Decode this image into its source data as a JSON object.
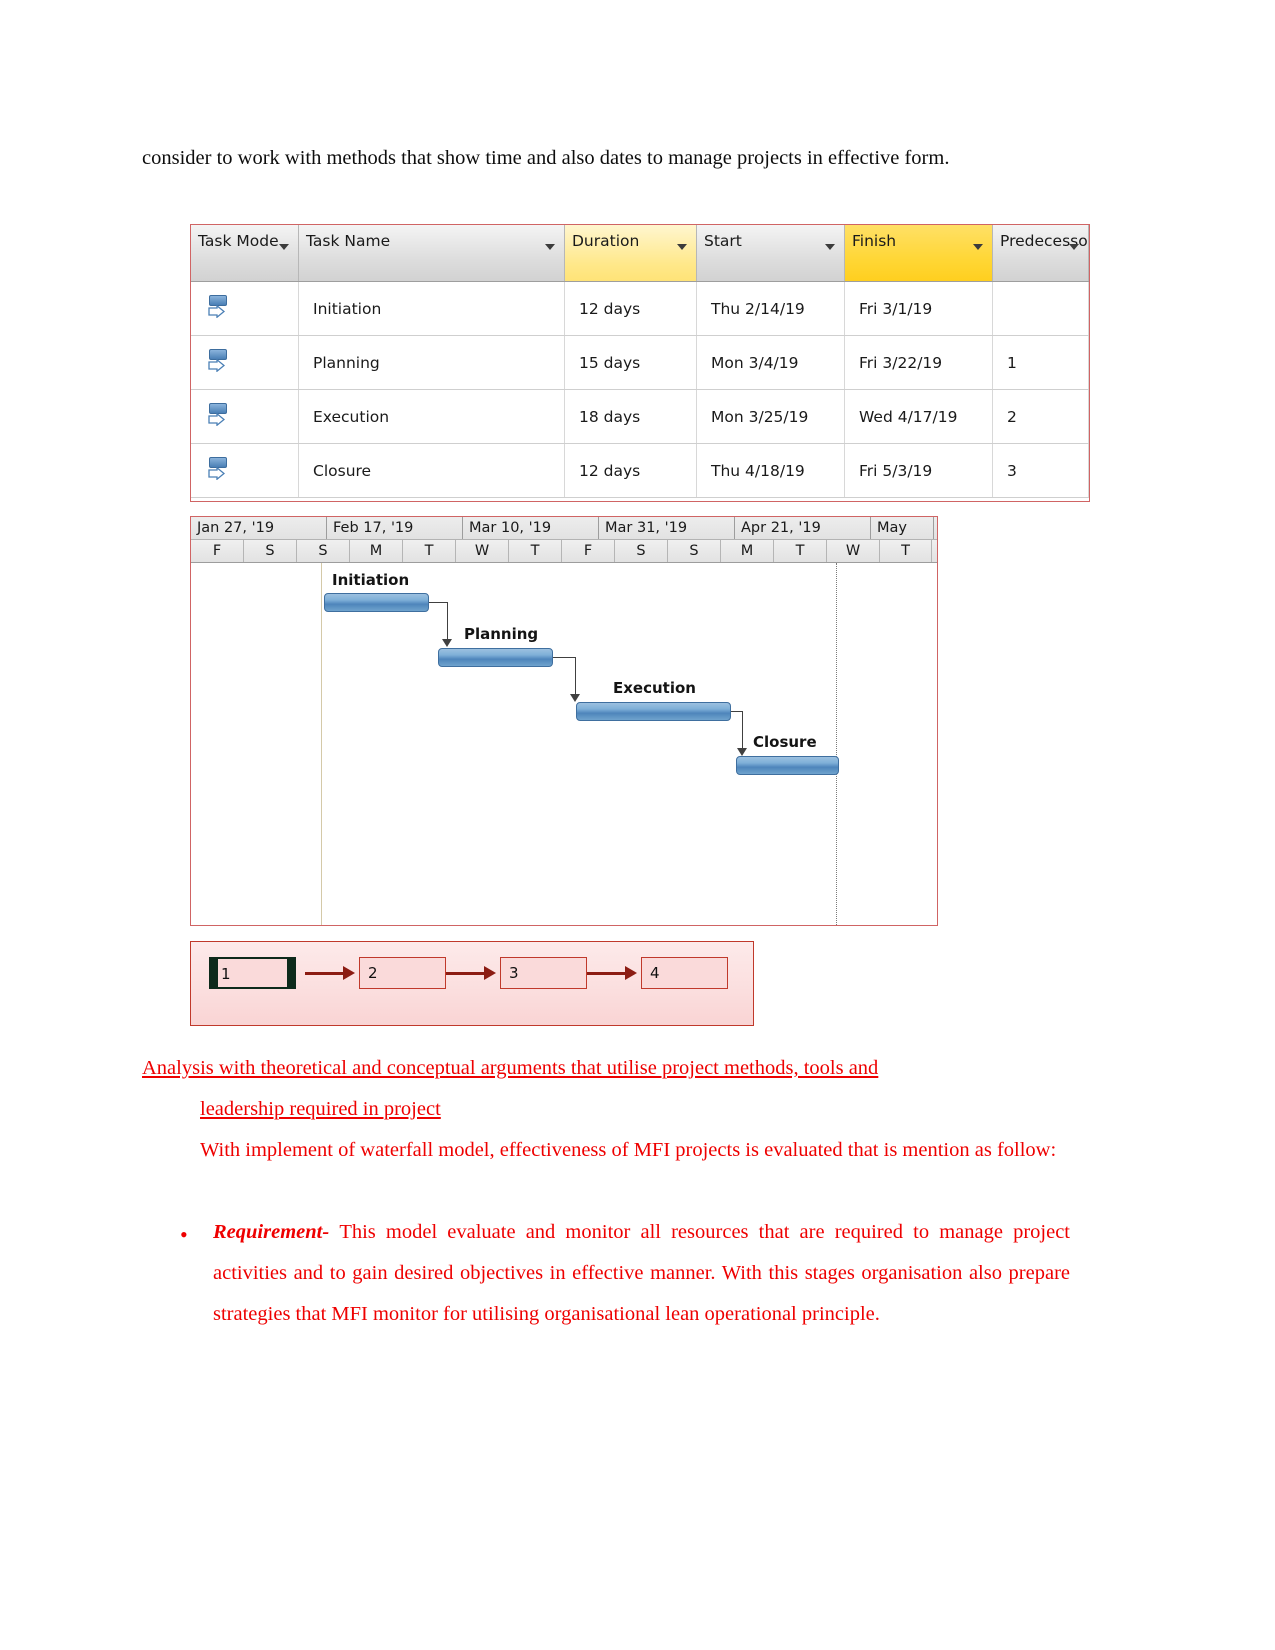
{
  "document": {
    "intro_paragraph": "consider to work with methods that show time and also dates to manage projects in effective form.",
    "heading": {
      "line1": "Analysis with theoretical and conceptual arguments that utilise project methods, tools and",
      "line2": "leadership required in project "
    },
    "waterfall_intro": "With implement of waterfall model, effectiveness of MFI projects is evaluated that is mention as follow:",
    "bullets": [
      {
        "term": "Requirement",
        "dash": "- ",
        "text": "This model evaluate and monitor all resources that are required to manage project activities and to gain desired objectives in effective manner. With this stages organisation also prepare strategies that MFI monitor for utilising organisational lean operational principle."
      }
    ]
  },
  "project_table": {
    "columns": [
      {
        "label": "Task Mode",
        "highlight": "none",
        "dropdown": "chevron-down-icon"
      },
      {
        "label": "Task Name",
        "highlight": "none",
        "dropdown": "chevron-down-icon"
      },
      {
        "label": "Duration",
        "highlight": "light",
        "dropdown": "chevron-down-icon"
      },
      {
        "label": "Start",
        "highlight": "none",
        "dropdown": "chevron-down-icon"
      },
      {
        "label": "Finish",
        "highlight": "strong",
        "dropdown": "chevron-down-icon"
      },
      {
        "label": "Predecessors",
        "highlight": "none",
        "dropdown": "chevron-down-icon"
      }
    ],
    "rows": [
      {
        "mode": "auto-schedule-icon",
        "name": "Initiation",
        "duration": "12 days",
        "start": "Thu 2/14/19",
        "finish": "Fri 3/1/19",
        "predecessors": ""
      },
      {
        "mode": "auto-schedule-icon",
        "name": "Planning",
        "duration": "15 days",
        "start": "Mon 3/4/19",
        "finish": "Fri 3/22/19",
        "predecessors": "1"
      },
      {
        "mode": "auto-schedule-icon",
        "name": "Execution",
        "duration": "18 days",
        "start": "Mon 3/25/19",
        "finish": "Wed 4/17/19",
        "predecessors": "2"
      },
      {
        "mode": "auto-schedule-icon",
        "name": "Closure",
        "duration": "12 days",
        "start": "Thu 4/18/19",
        "finish": "Fri 5/3/19",
        "predecessors": "3"
      }
    ]
  },
  "gantt": {
    "months": [
      "Jan 27, '19",
      "Feb 17, '19",
      "Mar 10, '19",
      "Mar 31, '19",
      "Apr 21, '19",
      "May"
    ],
    "days": [
      "F",
      "S",
      "S",
      "M",
      "T",
      "W",
      "T",
      "F",
      "S",
      "S",
      "M",
      "T",
      "W",
      "T"
    ],
    "bars": [
      {
        "label": "Initiation",
        "start_pct": 18.5,
        "width_pct": 14.5,
        "row": 0
      },
      {
        "label": "Planning",
        "start_pct": 34.0,
        "width_pct": 16.0,
        "row": 1
      },
      {
        "label": "Execution",
        "start_pct": 52.0,
        "width_pct": 21.5,
        "row": 2
      },
      {
        "label": "Closure",
        "start_pct": 74.0,
        "width_pct": 14.0,
        "row": 3
      }
    ]
  },
  "network_diagram": {
    "nodes": [
      "1",
      "2",
      "3",
      "4"
    ],
    "critical_index": 0,
    "link_icon": "arrow-right-icon"
  },
  "colors": {
    "red_text": "#ee0000",
    "frame_red": "#c0392b",
    "gantt_bar": "#4e85bb",
    "header_highlight_light": "#ffe88a",
    "header_highlight_strong": "#ffd633"
  }
}
